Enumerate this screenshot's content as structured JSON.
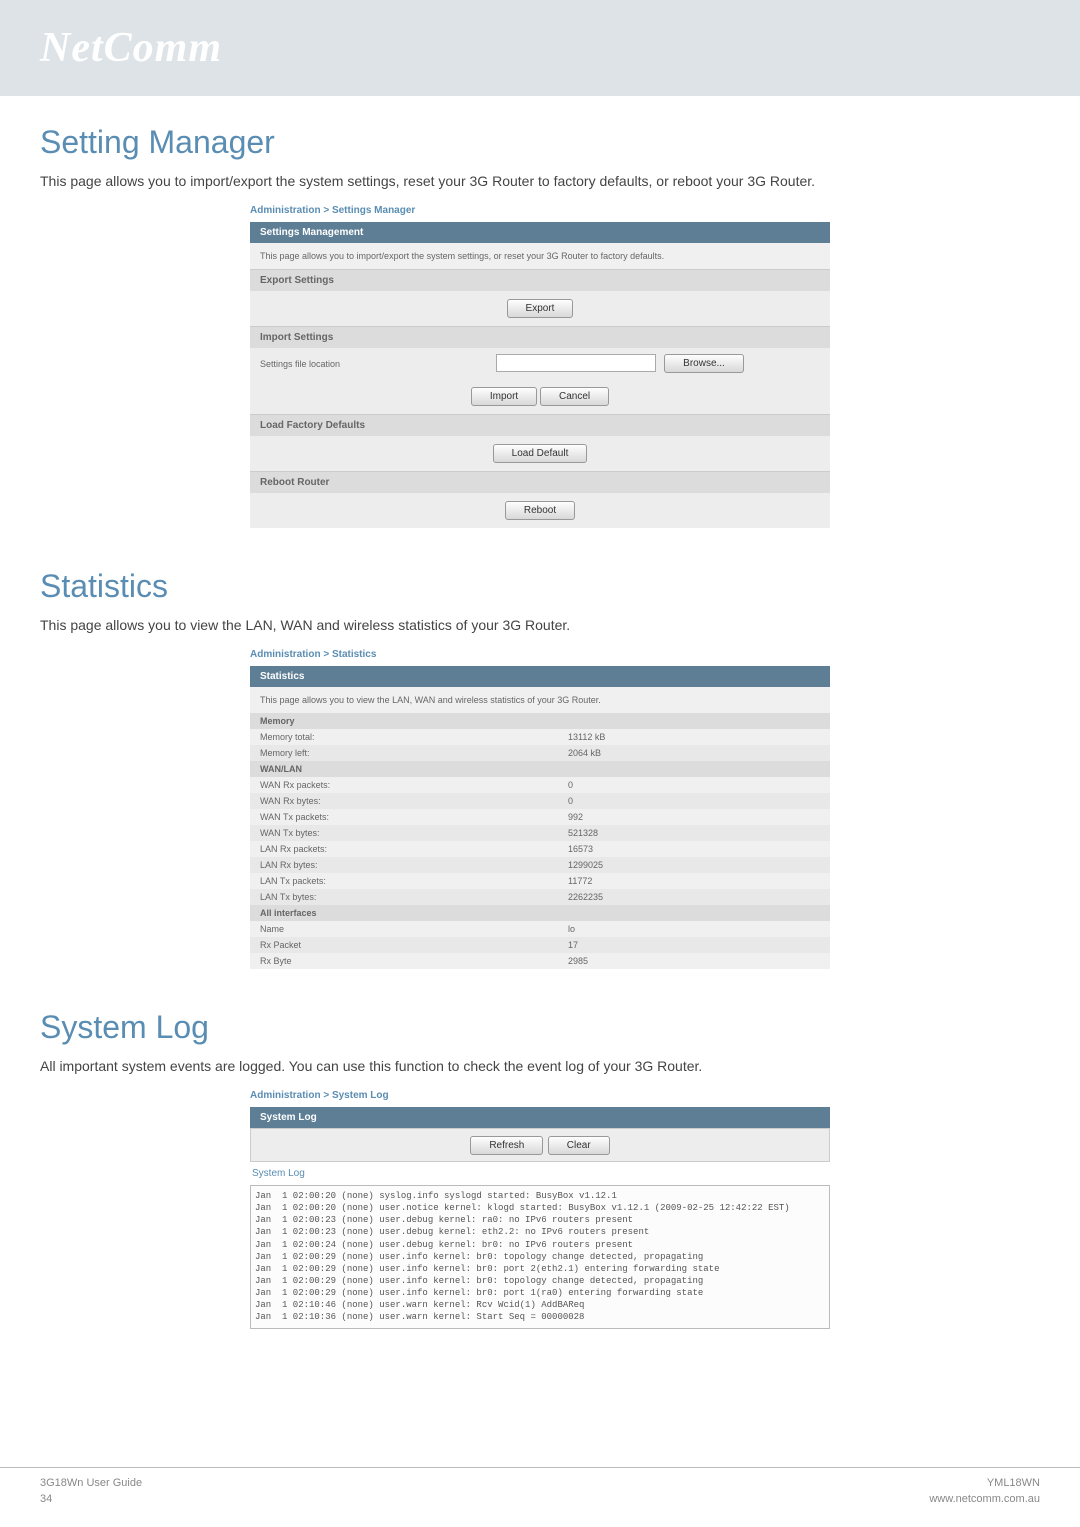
{
  "brand": "NetComm",
  "sections": {
    "settings": {
      "title": "Setting Manager",
      "desc": "This page allows you to import/export the system settings, reset your 3G Router to factory defaults, or reboot your 3G Router.",
      "breadcrumb": "Administration > Settings Manager",
      "panel_title": "Settings Management",
      "panel_desc": "This page allows you to import/export the system settings, or reset your 3G Router to factory defaults.",
      "export_title": "Export Settings",
      "export_btn": "Export",
      "import_title": "Import Settings",
      "import_label": "Settings file location",
      "browse_btn": "Browse...",
      "import_btn": "Import",
      "cancel_btn": "Cancel",
      "defaults_title": "Load Factory Defaults",
      "load_default_btn": "Load Default",
      "reboot_title": "Reboot Router",
      "reboot_btn": "Reboot"
    },
    "stats": {
      "title": "Statistics",
      "desc": "This page allows you to view the LAN, WAN and wireless statistics of your 3G Router.",
      "breadcrumb": "Administration > Statistics",
      "panel_title": "Statistics",
      "panel_desc": "This page allows you to view the LAN, WAN and wireless statistics of your 3G Router.",
      "groups": [
        {
          "head": "Memory",
          "rows": [
            {
              "k": "Memory total:",
              "v": "13112 kB"
            },
            {
              "k": "Memory left:",
              "v": "2064 kB"
            }
          ]
        },
        {
          "head": "WAN/LAN",
          "rows": [
            {
              "k": "WAN Rx packets:",
              "v": "0"
            },
            {
              "k": "WAN Rx bytes:",
              "v": "0"
            },
            {
              "k": "WAN Tx packets:",
              "v": "992"
            },
            {
              "k": "WAN Tx bytes:",
              "v": "521328"
            },
            {
              "k": "LAN Rx packets:",
              "v": "16573"
            },
            {
              "k": "LAN Rx bytes:",
              "v": "1299025"
            },
            {
              "k": "LAN Tx packets:",
              "v": "11772"
            },
            {
              "k": "LAN Tx bytes:",
              "v": "2262235"
            }
          ]
        },
        {
          "head": "All interfaces",
          "rows": [
            {
              "k": "Name",
              "v": "lo"
            },
            {
              "k": "Rx Packet",
              "v": "17"
            },
            {
              "k": "Rx Byte",
              "v": "2985"
            }
          ]
        }
      ]
    },
    "syslog": {
      "title": "System Log",
      "desc": "All important system events are logged. You can use this function to check the event log of your 3G Router.",
      "breadcrumb": "Administration > System Log",
      "panel_title": "System Log",
      "refresh_btn": "Refresh",
      "clear_btn": "Clear",
      "label": "System Log",
      "lines": [
        "Jan  1 02:00:20 (none) syslog.info syslogd started: BusyBox v1.12.1",
        "Jan  1 02:00:20 (none) user.notice kernel: klogd started: BusyBox v1.12.1 (2009-02-25 12:42:22 EST)",
        "Jan  1 02:00:23 (none) user.debug kernel: ra0: no IPv6 routers present",
        "Jan  1 02:00:23 (none) user.debug kernel: eth2.2: no IPv6 routers present",
        "Jan  1 02:00:24 (none) user.debug kernel: br0: no IPv6 routers present",
        "Jan  1 02:00:29 (none) user.info kernel: br0: topology change detected, propagating",
        "Jan  1 02:00:29 (none) user.info kernel: br0: port 2(eth2.1) entering forwarding state",
        "Jan  1 02:00:29 (none) user.info kernel: br0: topology change detected, propagating",
        "Jan  1 02:00:29 (none) user.info kernel: br0: port 1(ra0) entering forwarding state",
        "Jan  1 02:10:46 (none) user.warn kernel: Rcv Wcid(1) AddBAReq",
        "Jan  1 02:10:36 (none) user.warn kernel: Start Seq = 00000028"
      ]
    }
  },
  "footer": {
    "left1": "3G18Wn User Guide",
    "left2": "34",
    "right1": "YML18WN",
    "right2": "www.netcomm.com.au"
  }
}
